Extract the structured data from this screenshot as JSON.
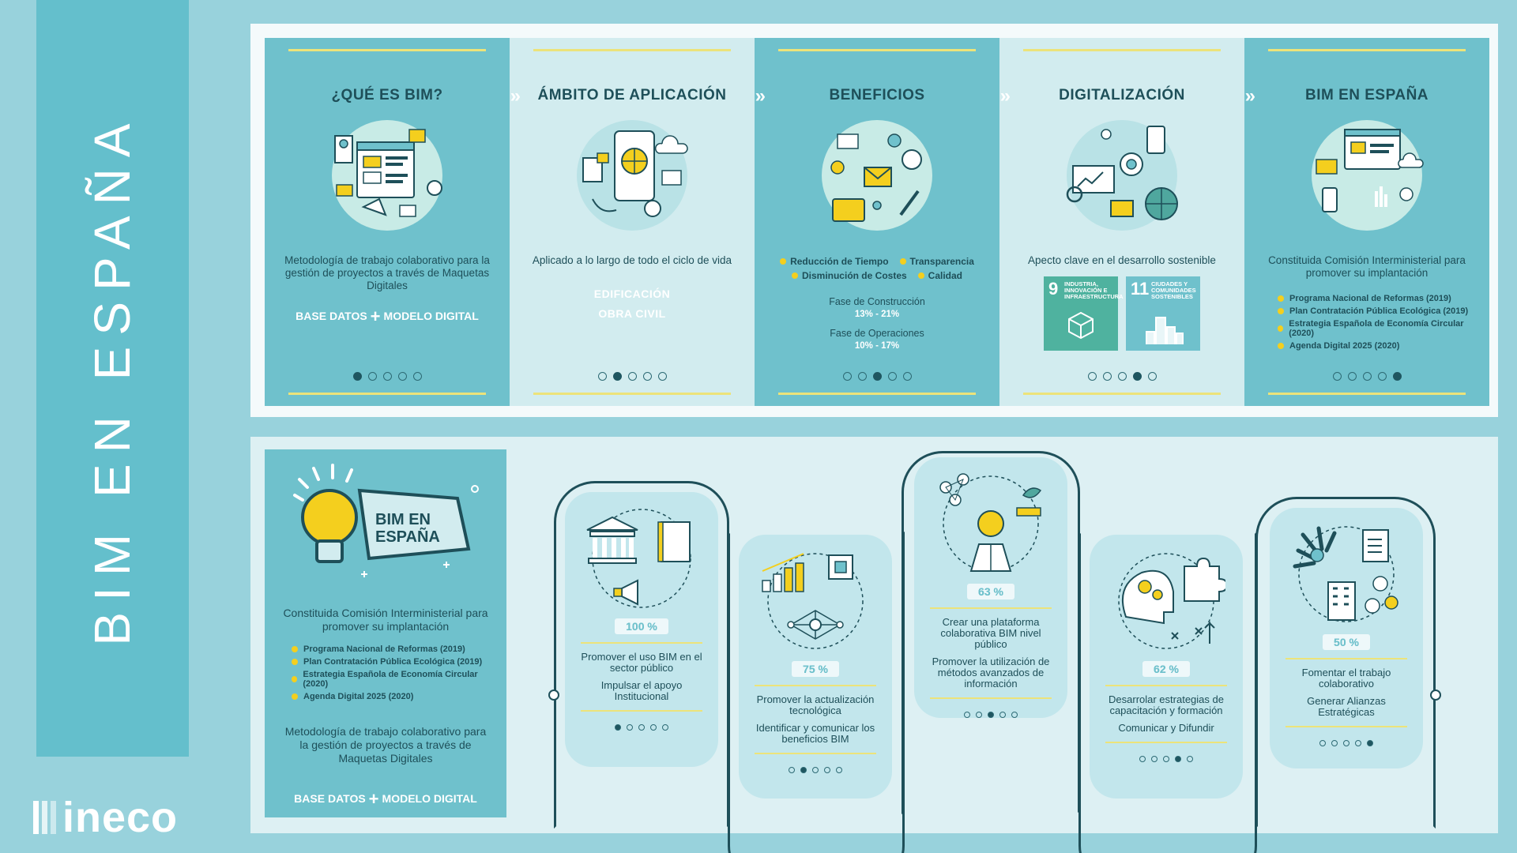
{
  "side": {
    "title": "BIM EN ESPAÑA",
    "brand": "ineco"
  },
  "colors": {
    "teal": "#6fc1cc",
    "light_teal": "#d2ecef",
    "dark": "#1e4f59",
    "yellow": "#f4cf1e",
    "sdg9": "#4fb29f"
  },
  "top_cards": [
    {
      "title": "¿QUÉ ES BIM?",
      "description": "Metodología de trabajo colaborativo para la gestión de proyectos a través de Maquetas Digitales",
      "formula": {
        "left": "BASE DATOS",
        "op": "+",
        "right": "MODELO DIGITAL"
      },
      "active_page": 0,
      "icon": "bim-workflow-illustration"
    },
    {
      "title": "ÁMBITO DE APLICACIÓN",
      "description": "Aplicado a lo largo de todo el ciclo de vida",
      "scope": [
        "EDIFICACIÓN",
        "OBRA CIVIL"
      ],
      "active_page": 1,
      "icon": "smartphone-globe-illustration"
    },
    {
      "title": "BENEFICIOS",
      "bullets": [
        "Reducción de Tiempo",
        "Transparencia",
        "Disminución de Costes",
        "Calidad"
      ],
      "phases": [
        {
          "label": "Fase de Construcción",
          "range": "13% - 21%"
        },
        {
          "label": "Fase de Operaciones",
          "range": "10% - 17%"
        }
      ],
      "active_page": 2,
      "icon": "benefits-illustration"
    },
    {
      "title": "DIGITALIZACIÓN",
      "description": "Apecto clave en el desarrollo sostenible",
      "sdgs": [
        {
          "number": "9",
          "label": "INDUSTRIA, INNOVACIÓN E INFRAESTRUCTURA"
        },
        {
          "number": "11",
          "label": "CIUDADES Y COMUNIDADES SOSTENIBLES"
        }
      ],
      "active_page": 3,
      "icon": "digital-network-illustration"
    },
    {
      "title": "BIM EN ESPAÑA",
      "description": "Constituida Comisión Interministerial para promover su implantación",
      "list": [
        "Programa Nacional de Reformas (2019)",
        "Plan Contratación Pública Ecológica (2019)",
        "Estrategia Española de Economía Circular (2020)",
        "Agenda Digital 2025 (2020)"
      ],
      "active_page": 4,
      "icon": "spain-bim-illustration"
    }
  ],
  "intro": {
    "badge_title_line1": "BIM EN",
    "badge_title_line2": "ESPAÑA",
    "description": "Constituida Comisión Interministerial para promover su implantación",
    "list": [
      "Programa Nacional de Reformas (2019)",
      "Plan Contratación Pública Ecológica (2019)",
      "Estrategia Española de Economía Circular (2020)",
      "Agenda Digital 2025 (2020)"
    ],
    "description2": "Metodología de trabajo colaborativo para la gestión de proyectos a través de Maquetas Digitales",
    "formula": {
      "left": "BASE DATOS",
      "op": "+",
      "right": "MODELO DIGITAL"
    }
  },
  "stages": [
    {
      "percent": "100 %",
      "line1": "Promover el uso BIM en el sector público",
      "line2": "Impulsar el apoyo Institucional",
      "active_page": 0,
      "icon": "government-building-icon"
    },
    {
      "percent": "75 %",
      "line1": "Promover la actualización tecnológica",
      "line2": "Identificar y comunicar los beneficios BIM",
      "active_page": 1,
      "icon": "tech-network-icon"
    },
    {
      "percent": "63 %",
      "line1": "Crear una plataforma colaborativa BIM nivel público",
      "line2": "Promover la utilización de métodos avanzados de información",
      "active_page": 2,
      "icon": "lightbulb-person-icon"
    },
    {
      "percent": "62 %",
      "line1": "Desarrolar estrategias de capacitación y formación",
      "line2": "Comunicar y Difundir",
      "active_page": 3,
      "icon": "puzzle-head-icon"
    },
    {
      "percent": "50 %",
      "line1": "Fomentar el trabajo colaborativo",
      "line2": "Generar Alianzas Estratégicas",
      "active_page": 4,
      "icon": "collaboration-icon"
    }
  ]
}
